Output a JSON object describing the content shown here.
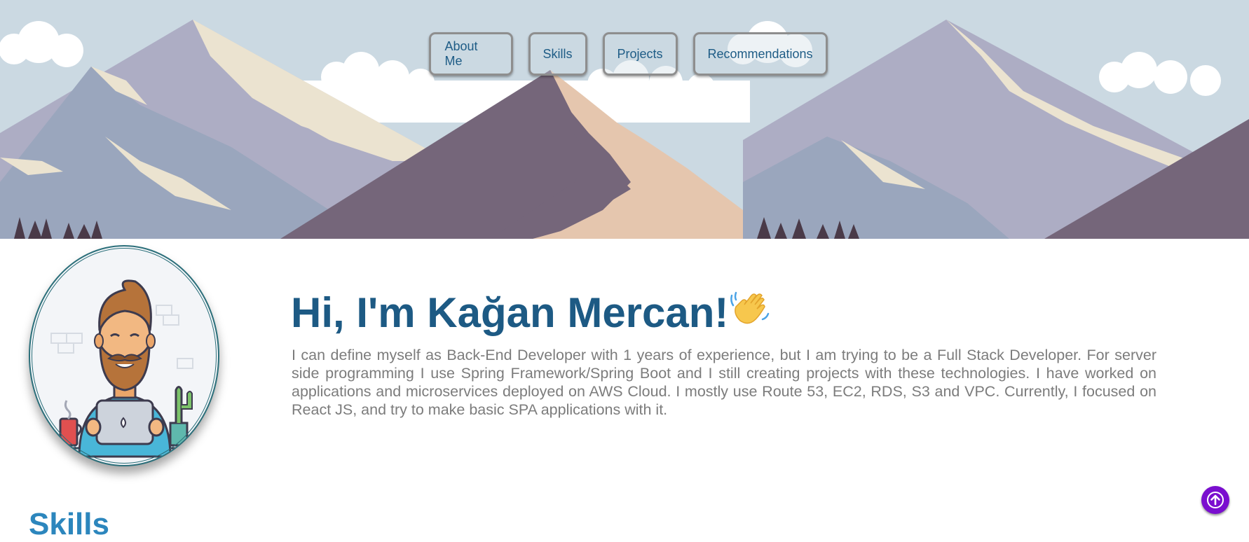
{
  "nav": {
    "items": [
      {
        "label": "About Me"
      },
      {
        "label": "Skills"
      },
      {
        "label": "Projects"
      },
      {
        "label": "Recommendations"
      }
    ]
  },
  "about": {
    "greeting": "Hi, I'm Kağan Mercan!",
    "wave_emoji": "waving-hand-icon",
    "bio": "I can define myself as Back-End Developer with 1 years of experience, but I am trying to be a Full Stack Developer. For server side programming I use Spring Framework/Spring Boot and I still creating projects with these technologies. I have worked on applications and microservices deployed on AWS Cloud. I mostly use Route 53, EC2, RDS, S3 and VPC. Currently, I focused on React JS, and try to make basic SPA applications with it."
  },
  "skills": {
    "heading": "Skills"
  },
  "scroll_top": {
    "icon": "arrow-up-icon"
  },
  "colors": {
    "sky": "#cbd9e2",
    "heading": "#1d5a84",
    "nav_text": "#1e5c86",
    "bio_text": "#7c7c7c",
    "skills_heading": "#2c86bd",
    "scroll_button": "#7a0ecf"
  }
}
